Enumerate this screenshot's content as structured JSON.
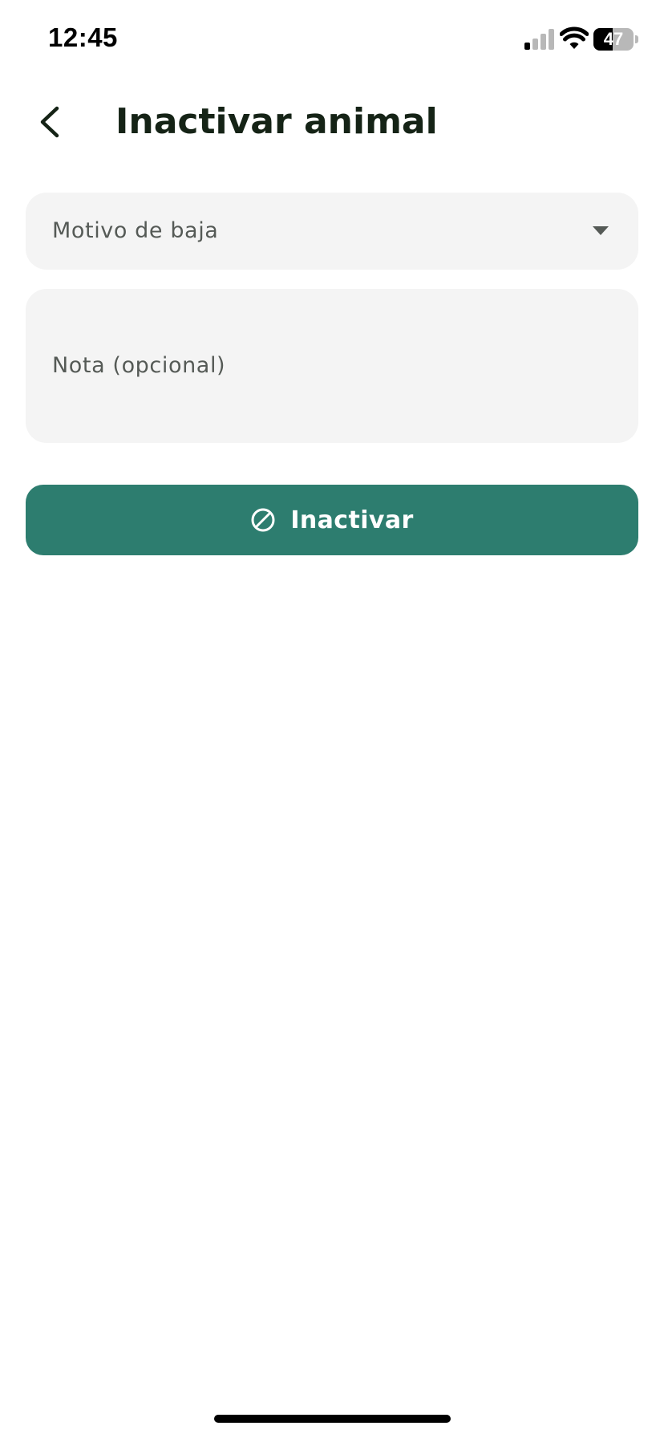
{
  "status_bar": {
    "time": "12:45",
    "battery_level": "47",
    "battery_fraction": 0.47
  },
  "header": {
    "title": "Inactivar animal",
    "back_icon": "chevron-left-icon"
  },
  "form": {
    "reason_select": {
      "label": "Motivo de baja",
      "icon": "caret-down-icon"
    },
    "note_field": {
      "placeholder": "Nota (opcional)"
    },
    "submit": {
      "label": "Inactivar",
      "icon": "ban-icon"
    }
  },
  "colors": {
    "accent": "#2d7d6f",
    "field_background": "#f4f4f4",
    "title_text": "#152316",
    "placeholder_text": "#555a56"
  }
}
